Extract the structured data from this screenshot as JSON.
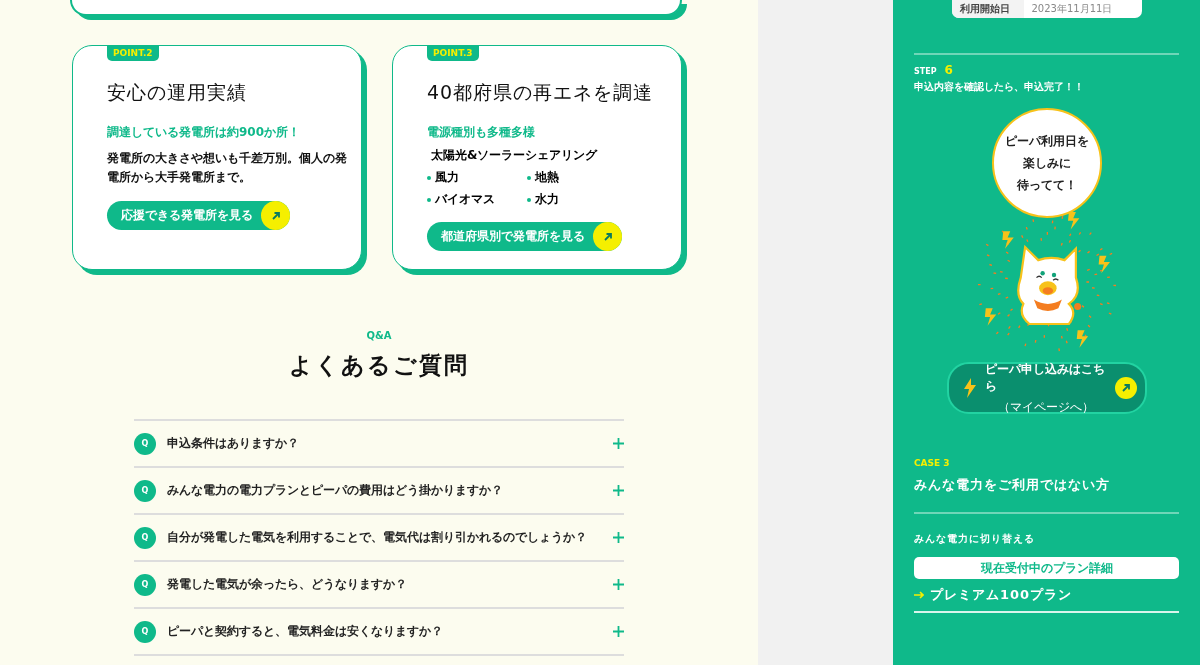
{
  "points": [
    {
      "badge": "POINT.2",
      "title": "安心の運用実績",
      "subtitle": "調達している発電所は約900か所！",
      "description": "発電所の大きさや想いも千差万別。個人の発電所から大手発電所まで。",
      "button": "応援できる発電所を見る"
    },
    {
      "badge": "POINT.3",
      "title": "40都府県の再エネを調達",
      "subtitle": "電源種別も多種多様",
      "item_rows": [
        [
          "太陽光&ソーラーシェアリング"
        ],
        [
          "風力",
          "地熱"
        ],
        [
          "バイオマス",
          "水力"
        ]
      ],
      "button": "都道府県別で発電所を見る"
    }
  ],
  "faq": {
    "eyebrow": "Q&A",
    "title": "よくあるご質問",
    "items": [
      {
        "mark": "Q",
        "question": "申込条件はありますか？",
        "expanded": false
      },
      {
        "mark": "Q",
        "question": "みんな電力の電力プランとピーパの費用はどう掛かりますか？",
        "expanded": false
      },
      {
        "mark": "Q",
        "question": "自分が発電した電気を利用することで、電気代は割り引かれるのでしょうか？",
        "expanded": false
      },
      {
        "mark": "Q",
        "question": "発電した電気が余ったら、どうなりますか？",
        "expanded": false
      },
      {
        "mark": "Q",
        "question": "ピーパと契約すると、電気料金は安くなりますか？",
        "expanded": false
      }
    ]
  },
  "side": {
    "table": {
      "label": "利用開始日",
      "value": "2023年11月11日"
    },
    "step_label": "STEP",
    "step_number": "6",
    "step_text": "申込内容を確認したら、申込完了！！",
    "bubble_lines": [
      "ピーパ利用日を",
      "楽しみに",
      "待ってて！"
    ],
    "cta": {
      "label": "ピーパ申し込みはこちら",
      "sub": "（マイページへ）"
    },
    "case_label": "CASE 3",
    "case_title": "みんな電力をご利用ではない方",
    "switch_text": "みんな電力に切り替える",
    "plan_button": "現在受付中のプラン詳細",
    "plans": [
      {
        "label": "プレミアム100プラン"
      }
    ]
  }
}
